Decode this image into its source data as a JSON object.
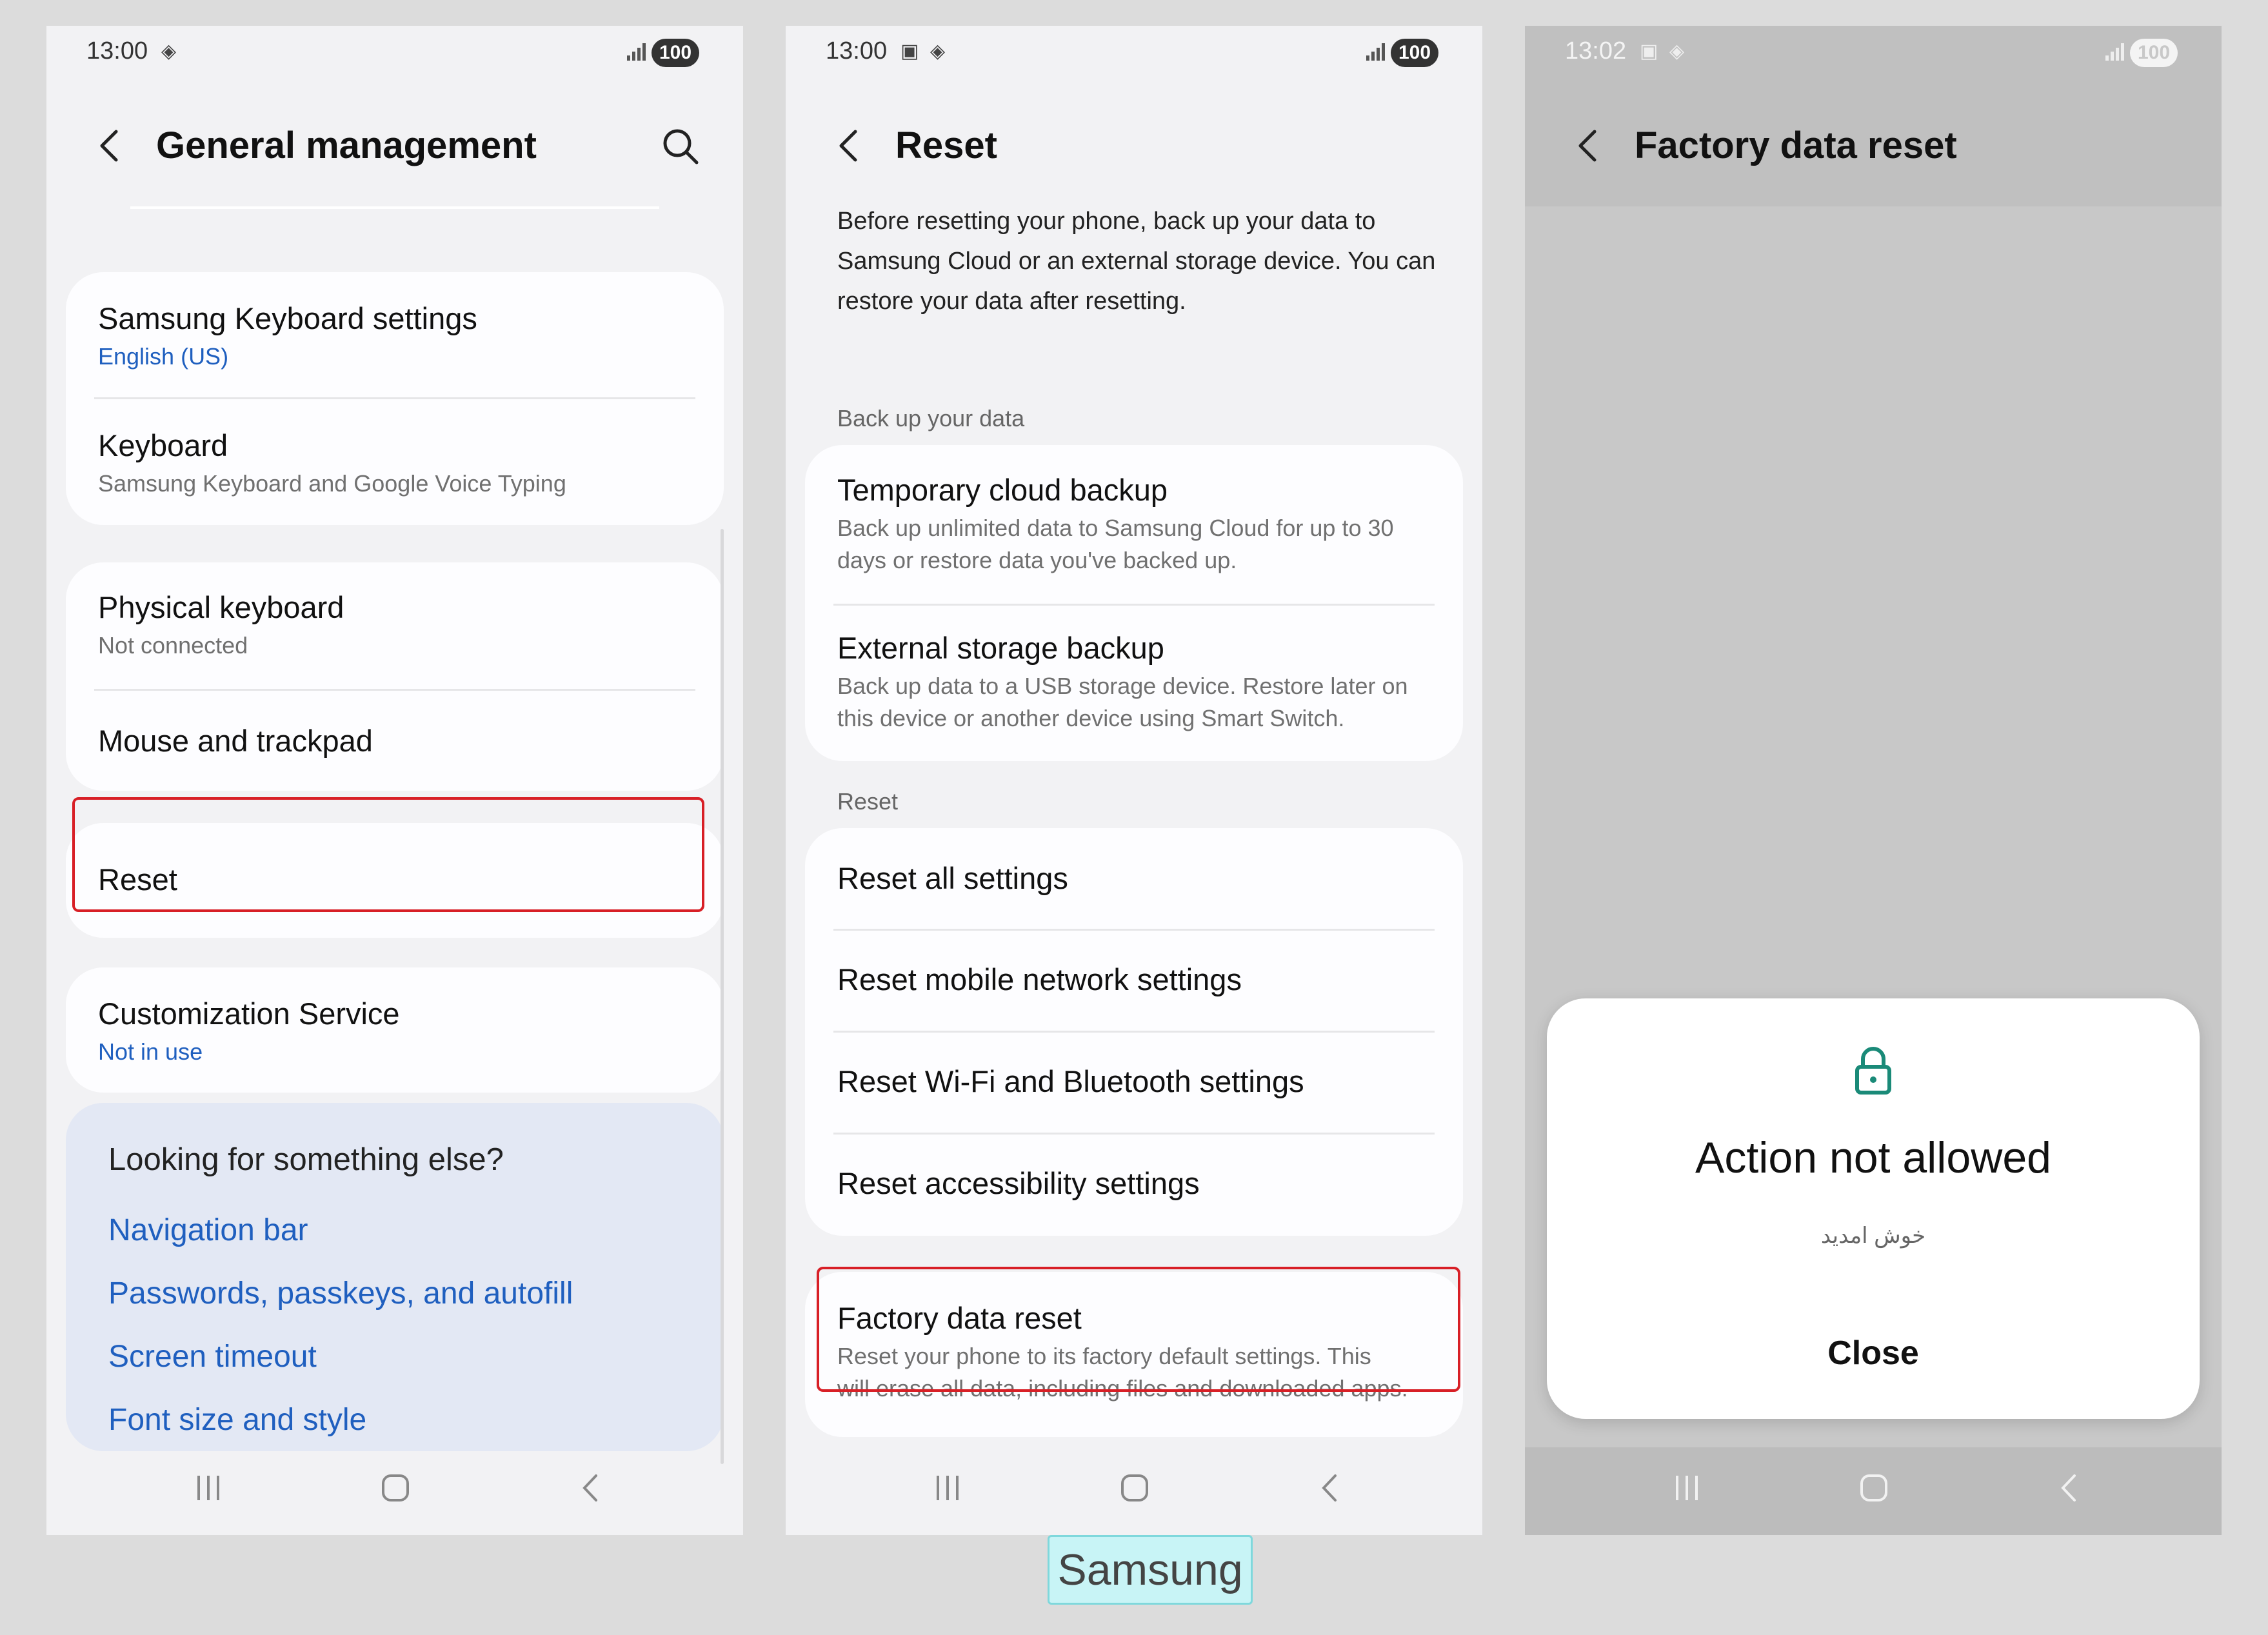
{
  "brand_label": "Samsung",
  "phone1": {
    "status": {
      "time": "13:00",
      "battery": "100"
    },
    "title": "General management",
    "cards": {
      "samsung_keyboard": {
        "title": "Samsung Keyboard settings",
        "subtitle": "English (US)"
      },
      "keyboard": {
        "title": "Keyboard",
        "subtitle": "Samsung Keyboard and Google Voice Typing"
      },
      "physical_keyboard": {
        "title": "Physical keyboard",
        "subtitle": "Not connected"
      },
      "mouse": {
        "title": "Mouse and trackpad"
      },
      "reset": {
        "title": "Reset"
      },
      "customization": {
        "title": "Customization Service",
        "subtitle": "Not in use"
      }
    },
    "suggestions": {
      "header": "Looking for something else?",
      "links": [
        "Navigation bar",
        "Passwords, passkeys, and autofill",
        "Screen timeout",
        "Font size and style"
      ]
    }
  },
  "phone2": {
    "status": {
      "time": "13:00",
      "battery": "100"
    },
    "title": "Reset",
    "intro": "Before resetting your phone, back up your data to Samsung Cloud or an external storage device. You can restore your data after resetting.",
    "backup_label": "Back up your data",
    "backup_items": [
      {
        "title": "Temporary cloud backup",
        "subtitle_1": "Back up unlimited data to Samsung Cloud for up to 30",
        "subtitle_2": "days or restore data you've backed up."
      },
      {
        "title": "External storage backup",
        "subtitle_1": "Back up data to a USB storage device. Restore later on",
        "subtitle_2": "this device or another device using Smart Switch."
      }
    ],
    "reset_label": "Reset",
    "reset_items": [
      "Reset all settings",
      "Reset mobile network settings",
      "Reset Wi-Fi and Bluetooth settings",
      "Reset accessibility settings"
    ],
    "factory": {
      "title": "Factory data reset",
      "subtitle_1": "Reset your phone to its factory default settings. This",
      "subtitle_2": "will erase all data, including files and downloaded apps."
    }
  },
  "phone3": {
    "status": {
      "time": "13:02",
      "battery": "100"
    },
    "title": "Factory data reset",
    "dialog": {
      "title": "Action not allowed",
      "message": "خوش امدید",
      "button": "Close"
    }
  },
  "icons": {
    "back": "chevron-left-icon",
    "search": "search-icon",
    "lock": "lock-icon",
    "nav_recents": "recents-icon",
    "nav_home": "home-icon",
    "nav_back": "nav-back-icon"
  },
  "colors": {
    "link_blue": "#1f5fbf",
    "highlight_red": "#d81f26",
    "lock_teal": "#1a8a78",
    "brand_bg": "#c8f4f6"
  }
}
